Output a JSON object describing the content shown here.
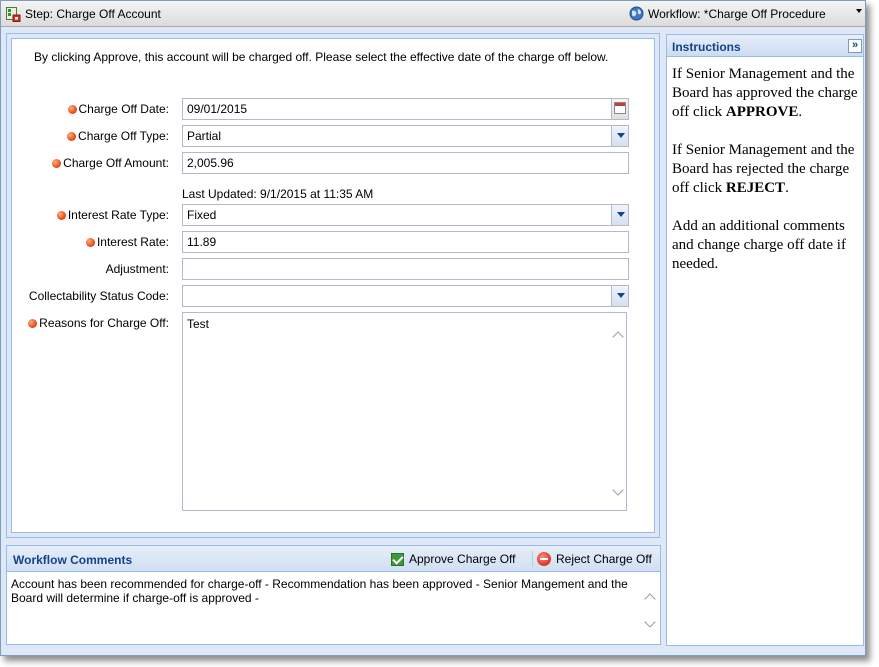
{
  "titlebar": {
    "step_label": "Step: Charge Off Account",
    "workflow_label": "Workflow: *Charge Off Procedure"
  },
  "form": {
    "intro": "By clicking Approve, this account will be charged off. Please select the effective date of the charge off below.",
    "fields": {
      "charge_off_date": {
        "label": "Charge Off Date:",
        "value": "09/01/2015",
        "required": true
      },
      "charge_off_type": {
        "label": "Charge Off Type:",
        "value": "Partial",
        "required": true
      },
      "charge_off_amount": {
        "label": "Charge Off Amount:",
        "value": "2,005.96",
        "required": true
      },
      "last_updated": "Last Updated: 9/1/2015 at 11:35 AM",
      "interest_rate_type": {
        "label": "Interest Rate Type:",
        "value": "Fixed",
        "required": true
      },
      "interest_rate": {
        "label": "Interest Rate:",
        "value": "11.89",
        "required": true
      },
      "adjustment": {
        "label": "Adjustment:",
        "value": "",
        "required": false
      },
      "collectability_status_code": {
        "label": "Collectability Status Code:",
        "value": "",
        "required": false
      },
      "reasons_for_charge_off": {
        "label": "Reasons for Charge Off:",
        "value": "Test",
        "required": true
      }
    }
  },
  "comments": {
    "title": "Workflow Comments",
    "approve_label": "Approve Charge Off",
    "reject_label": "Reject Charge Off",
    "body": " Account has been recommended for charge-off -  Recommendation has been approved - Senior Mangement and the Board will determine if charge-off is approved -"
  },
  "instructions": {
    "title": "Instructions",
    "approve_before": "If Senior Management and the Board has approved the charge off click ",
    "approve_keyword": "APPROVE",
    "approve_after": ".",
    "reject_before": "If Senior Management and the Board has rejected the charge off click ",
    "reject_keyword": "REJECT",
    "reject_after": ".",
    "additional": "Add an additional comments and change charge off date if needed."
  },
  "colors": {
    "accent": "#15428b",
    "panel_bg": "#dfe8f6",
    "border": "#99bbe8",
    "required_dot": "#e8501a"
  },
  "icons": {
    "step": "step-icon",
    "workflow": "globe-icon",
    "calendar": "calendar-icon",
    "approve": "checkbox-check-icon",
    "reject": "minus-circle-icon",
    "collapse": "double-chevron-right-icon"
  }
}
